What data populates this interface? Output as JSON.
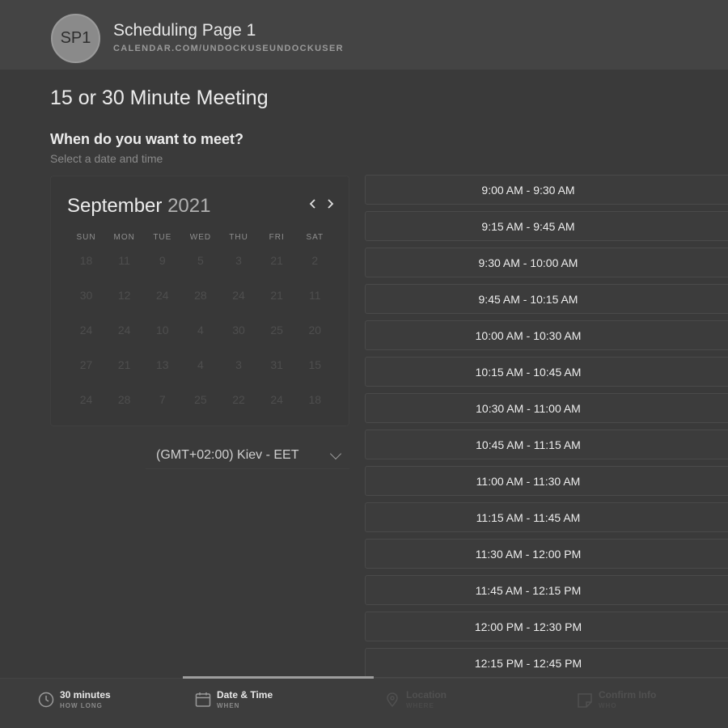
{
  "header": {
    "avatar_initials": "SP1",
    "page_name": "Scheduling Page 1",
    "page_url": "CALENDAR.COM/UNDOCKUSEUNDOCKUSER"
  },
  "meeting_title": "15 or 30 Minute Meeting",
  "question": "When do you want to meet?",
  "subtitle": "Select a date and time",
  "calendar": {
    "month": "September",
    "year": "2021",
    "prev_icon": "chevron-left-icon",
    "next_icon": "chevron-right-icon",
    "weekdays": [
      "SUN",
      "MON",
      "TUE",
      "WED",
      "THU",
      "FRI",
      "SAT"
    ],
    "weeks": [
      [
        "18",
        "11",
        "9",
        "5",
        "3",
        "21",
        "2"
      ],
      [
        "30",
        "12",
        "24",
        "28",
        "24",
        "21",
        "11"
      ],
      [
        "24",
        "24",
        "10",
        "4",
        "30",
        "25",
        "20"
      ],
      [
        "27",
        "21",
        "13",
        "4",
        "3",
        "31",
        "15"
      ],
      [
        "24",
        "28",
        "7",
        "25",
        "22",
        "24",
        "18"
      ]
    ]
  },
  "timezone": {
    "label": "(GMT+02:00) Kiev - EET",
    "icon": "chevron-down-icon"
  },
  "time_slots": [
    "9:00 AM - 9:30 AM",
    "9:15 AM - 9:45 AM",
    "9:30 AM - 10:00 AM",
    "9:45 AM - 10:15 AM",
    "10:00 AM - 10:30 AM",
    "10:15 AM - 10:45 AM",
    "10:30 AM - 11:00 AM",
    "10:45 AM - 11:15 AM",
    "11:00 AM - 11:30 AM",
    "11:15 AM - 11:45 AM",
    "11:30 AM - 12:00 PM",
    "11:45 AM - 12:15 PM",
    "12:00 PM - 12:30 PM",
    "12:15 PM - 12:45 PM"
  ],
  "steps": [
    {
      "title": "30 minutes",
      "sub": "HOW LONG",
      "icon": "clock-icon",
      "state": "done"
    },
    {
      "title": "Date & Time",
      "sub": "WHEN",
      "icon": "calendar-icon",
      "state": "active"
    },
    {
      "title": "Location",
      "sub": "WHERE",
      "icon": "location-pin-icon",
      "state": "pending"
    },
    {
      "title": "Confirm Info",
      "sub": "WHO",
      "icon": "note-icon",
      "state": "pending"
    }
  ],
  "colors": {
    "background": "#3a3a3a",
    "header": "#444444",
    "accent": "#9e9e9e"
  }
}
